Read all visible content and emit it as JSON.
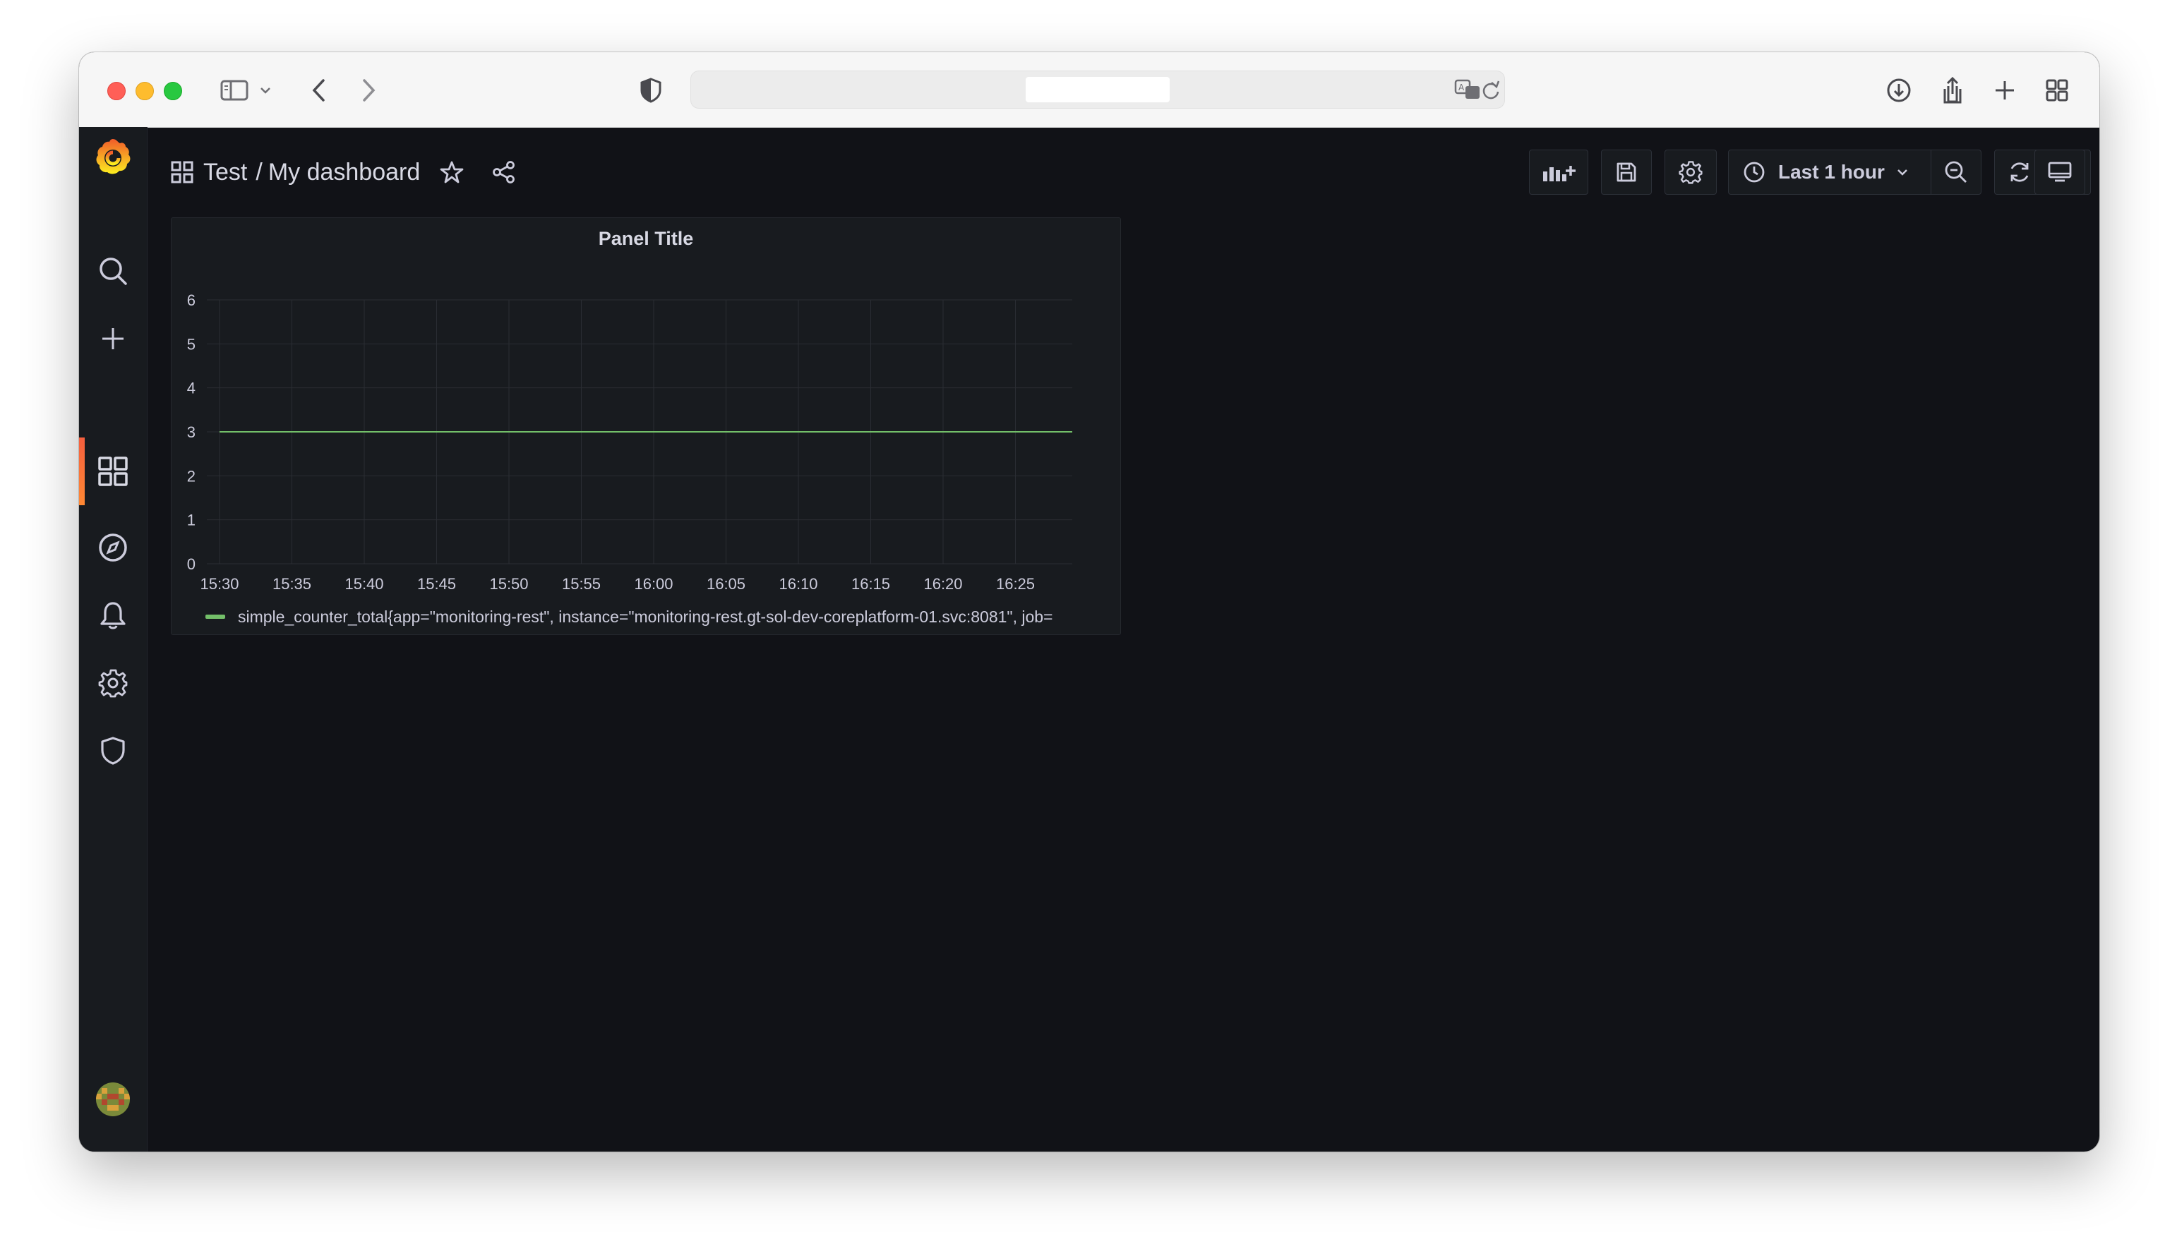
{
  "browser": {
    "icons": [
      "sidebar-toggle-icon",
      "chevron-down-icon",
      "back-icon",
      "forward-icon",
      "shield-icon",
      "translate-icon",
      "reload-icon",
      "download-icon",
      "share-icon",
      "new-tab-icon",
      "tab-overview-icon"
    ]
  },
  "header": {
    "folder": "Test",
    "separator": "/",
    "dashboard": "My dashboard"
  },
  "toolbar": {
    "time_range": "Last 1 hour"
  },
  "panel": {
    "title": "Panel Title"
  },
  "colors": {
    "background": "#111217",
    "panel": "#181b1f",
    "series": "#73bf69",
    "accent": "#f55f3e"
  },
  "chart_data": {
    "type": "line",
    "title": "Panel Title",
    "x_ticks": [
      "15:30",
      "15:35",
      "15:40",
      "15:45",
      "15:50",
      "15:55",
      "16:00",
      "16:05",
      "16:10",
      "16:15",
      "16:20",
      "16:25"
    ],
    "y_ticks": [
      "0",
      "1",
      "2",
      "3",
      "4",
      "5",
      "6"
    ],
    "ylim": [
      0,
      6
    ],
    "grid": true,
    "legend": "bottom-left",
    "series": [
      {
        "name": "simple_counter_total{app=\"monitoring-rest\", instance=\"monitoring-rest.gt-sol-dev-coreplatform-01.svc:8081\", job=",
        "color": "#73bf69",
        "x": [
          "15:30",
          "16:29"
        ],
        "values": [
          3,
          3
        ]
      }
    ]
  }
}
